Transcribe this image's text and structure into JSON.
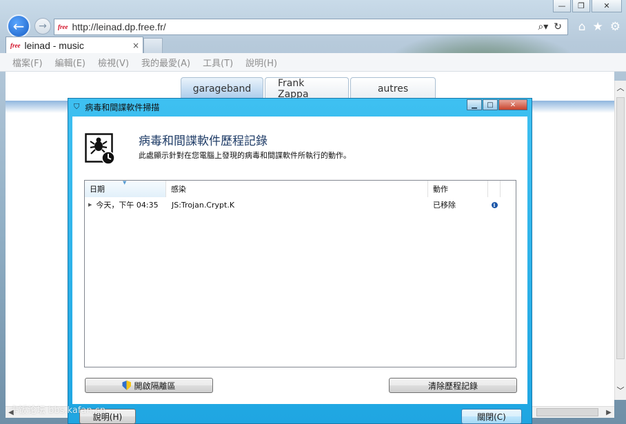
{
  "browser": {
    "address": {
      "favicon": "free",
      "url": "http://leinad.dp.free.fr/"
    },
    "tab": {
      "favicon": "free",
      "title": "leinad - music",
      "close": "×"
    },
    "window_controls": {
      "minimize": "—",
      "restore": "❐",
      "close": "✕"
    },
    "menu": [
      {
        "label": "檔案(F)"
      },
      {
        "label": "編輯(E)"
      },
      {
        "label": "檢視(V)"
      },
      {
        "label": "我的最愛(A)"
      },
      {
        "label": "工具(T)"
      },
      {
        "label": "說明(H)"
      }
    ],
    "icons": {
      "back": "arrow-left-icon",
      "forward": "arrow-right-icon",
      "search": "search-icon",
      "refresh": "refresh-icon",
      "home": "home-icon",
      "favorites": "star-icon",
      "settings": "gear-icon"
    }
  },
  "site": {
    "tabs": [
      {
        "label": "garageband",
        "active": true
      },
      {
        "label": "Frank Zappa",
        "active": false
      },
      {
        "label": "autres",
        "active": false
      }
    ]
  },
  "dialog": {
    "title": "病毒和間諜軟件掃描",
    "heading": "病毒和間諜軟件歷程記錄",
    "description": "此處顯示針對在您電腦上發現的病毒和間諜軟件所執行的動作。",
    "columns": {
      "date": "日期",
      "infection": "感染",
      "action": "動作"
    },
    "rows": [
      {
        "date": "今天，下午 04:35",
        "infection": "JS:Trojan.Crypt.K",
        "action": "已移除"
      }
    ],
    "buttons": {
      "quarantine": "開啟隔離區",
      "clear_history": "清除歷程記錄",
      "help": "說明(H)",
      "close": "關閉(C)"
    }
  },
  "watermark": "卡饭论坛 bbs.kafan.cn",
  "colors": {
    "dialog_frame": "#1fa6e2",
    "accent_blue": "#1b56a8",
    "heading_text": "#1f3c67"
  }
}
